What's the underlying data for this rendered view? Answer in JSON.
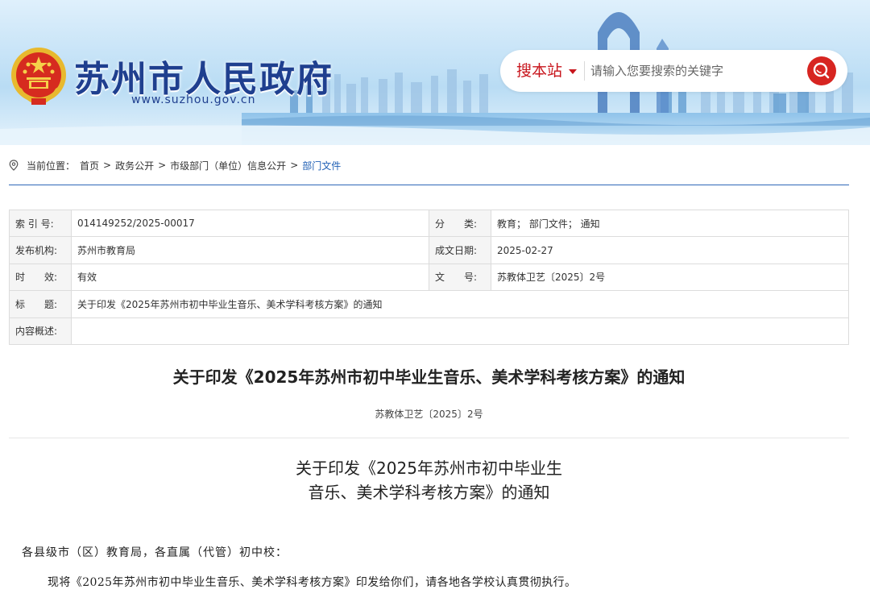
{
  "header": {
    "site_title": "苏州市人民政府",
    "site_url": "www.suzhou.gov.cn",
    "emblem_icon": "national-emblem-icon",
    "search": {
      "scope_label": "搜本站",
      "placeholder": "请输入您要搜索的关键字",
      "button_icon": "search-icon",
      "accent_color": "#d72521"
    }
  },
  "breadcrumb": {
    "prefix": "当前位置：",
    "items": [
      "首页",
      "政务公开",
      "市级部门（单位）信息公开",
      "部门文件"
    ],
    "separator": ">"
  },
  "meta": {
    "index_label": "索 引 号:",
    "index_value": "014149252/2025-00017",
    "category_label": "分　　类:",
    "category_value": "教育；  部门文件；  通知",
    "publisher_label": "发布机构:",
    "publisher_value": "苏州市教育局",
    "date_label": "成文日期:",
    "date_value": "2025-02-27",
    "validity_label": "时　　效:",
    "validity_value": "有效",
    "docno_label": "文　　号:",
    "docno_value": "苏教体卫艺〔2025〕2号",
    "title_label": "标　　题:",
    "title_value": "关于印发《2025年苏州市初中毕业生音乐、美术学科考核方案》的通知",
    "summary_label": "内容概述:",
    "summary_value": ""
  },
  "article": {
    "title": "关于印发《2025年苏州市初中毕业生音乐、美术学科考核方案》的通知",
    "doc_number": "苏教体卫艺〔2025〕2号",
    "body_title_line1": "关于印发《2025年苏州市初中毕业生",
    "body_title_line2": "音乐、美术学科考核方案》的通知",
    "salutation": "各县级市（区）教育局，各直属（代管）初中校：",
    "paragraph": "现将《2025年苏州市初中毕业生音乐、美术学科考核方案》印发给你们，请各地各学校认真贯彻执行。"
  }
}
